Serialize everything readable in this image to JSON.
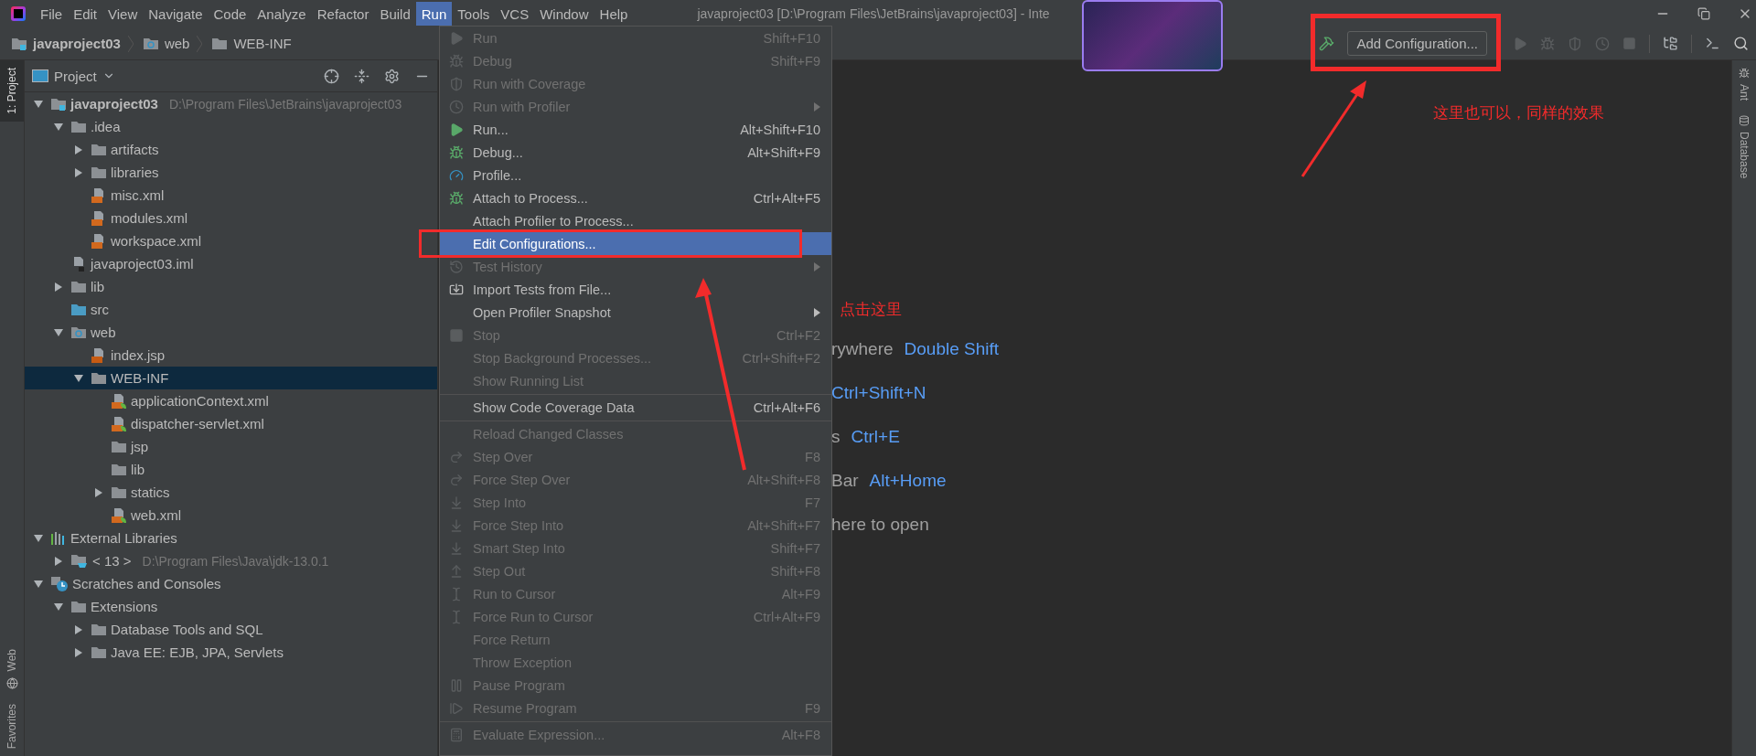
{
  "title_bar": {
    "menus": [
      {
        "label": "File",
        "selected": false
      },
      {
        "label": "Edit",
        "selected": false
      },
      {
        "label": "View",
        "selected": false
      },
      {
        "label": "Navigate",
        "selected": false
      },
      {
        "label": "Code",
        "selected": false
      },
      {
        "label": "Analyze",
        "selected": false
      },
      {
        "label": "Refactor",
        "selected": false
      },
      {
        "label": "Build",
        "selected": false
      },
      {
        "label": "Run",
        "selected": true
      },
      {
        "label": "Tools",
        "selected": false
      },
      {
        "label": "VCS",
        "selected": false
      },
      {
        "label": "Window",
        "selected": false
      },
      {
        "label": "Help",
        "selected": false
      }
    ],
    "title": "javaproject03 [D:\\Program Files\\JetBrains\\javaproject03] - Inte"
  },
  "nav_bar": {
    "breadcrumbs": [
      {
        "label": "javaproject03",
        "kind": "module"
      },
      {
        "label": "web",
        "kind": "web-folder"
      },
      {
        "label": "WEB-INF",
        "kind": "folder"
      }
    ],
    "run_config_button": "Add Configuration..."
  },
  "left_strip": {
    "top": [
      {
        "label": "1: Project",
        "selected": true
      }
    ],
    "bottom": [
      {
        "label": "Web",
        "selected": false
      },
      {
        "label": "Favorites",
        "selected": false
      }
    ]
  },
  "right_strip": [
    {
      "label": "Ant"
    },
    {
      "label": "Database"
    }
  ],
  "project_panel": {
    "title": "Project",
    "tree": [
      {
        "label": "javaproject03",
        "kind": "module",
        "path": "D:\\Program Files\\JetBrains\\javaproject03",
        "expanded": true,
        "selected": false,
        "children": [
          {
            "label": ".idea",
            "kind": "folder",
            "expanded": true,
            "selected": false,
            "children": [
              {
                "label": "artifacts",
                "kind": "folder",
                "expanded": false,
                "selected": false
              },
              {
                "label": "libraries",
                "kind": "folder",
                "expanded": false,
                "selected": false
              },
              {
                "label": "misc.xml",
                "kind": "xml-file",
                "selected": false
              },
              {
                "label": "modules.xml",
                "kind": "xml-file",
                "selected": false
              },
              {
                "label": "workspace.xml",
                "kind": "xml-file",
                "selected": false
              }
            ]
          },
          {
            "label": "javaproject03.iml",
            "kind": "iml-file",
            "selected": false
          },
          {
            "label": "lib",
            "kind": "folder",
            "expanded": false,
            "selected": false
          },
          {
            "label": "src",
            "kind": "source-folder",
            "selected": false
          },
          {
            "label": "web",
            "kind": "web-folder",
            "expanded": true,
            "selected": false,
            "children": [
              {
                "label": "index.jsp",
                "kind": "jsp-file",
                "selected": false
              },
              {
                "label": "WEB-INF",
                "kind": "folder",
                "expanded": true,
                "selected": true,
                "children": [
                  {
                    "label": "applicationContext.xml",
                    "kind": "spring-xml",
                    "selected": false
                  },
                  {
                    "label": "dispatcher-servlet.xml",
                    "kind": "spring-xml",
                    "selected": false
                  },
                  {
                    "label": "jsp",
                    "kind": "folder",
                    "selected": false
                  },
                  {
                    "label": "lib",
                    "kind": "folder",
                    "selected": false
                  },
                  {
                    "label": "statics",
                    "kind": "folder",
                    "expanded": false,
                    "selected": false
                  },
                  {
                    "label": "web.xml",
                    "kind": "web-xml",
                    "selected": false
                  }
                ]
              }
            ]
          }
        ]
      },
      {
        "label": "External Libraries",
        "kind": "libraries",
        "expanded": true,
        "selected": false,
        "children": [
          {
            "label": "< 13 >",
            "kind": "sdk",
            "path": "D:\\Program Files\\Java\\jdk-13.0.1",
            "expanded": false,
            "selected": false
          }
        ]
      },
      {
        "label": "Scratches and Consoles",
        "kind": "scratches",
        "expanded": true,
        "selected": false,
        "children": [
          {
            "label": "Extensions",
            "kind": "folder",
            "expanded": true,
            "selected": false,
            "children": [
              {
                "label": "Database Tools and SQL",
                "kind": "folder",
                "expanded": false,
                "selected": false
              },
              {
                "label": "Java EE: EJB, JPA, Servlets",
                "kind": "folder",
                "expanded": false,
                "selected": false
              }
            ]
          }
        ]
      }
    ]
  },
  "run_menu": {
    "items": [
      {
        "kind": "command",
        "label": "Run",
        "shortcut": "Shift+F10",
        "disabled": true,
        "selected": false
      },
      {
        "kind": "command",
        "label": "Debug",
        "shortcut": "Shift+F9",
        "disabled": true,
        "selected": false
      },
      {
        "kind": "command",
        "label": "Run with Coverage",
        "disabled": true,
        "selected": false
      },
      {
        "kind": "command",
        "label": "Run with Profiler",
        "disabled": true,
        "submenu": true,
        "selected": false
      },
      {
        "kind": "command",
        "label": "Run...",
        "shortcut": "Alt+Shift+F10",
        "disabled": false,
        "selected": false
      },
      {
        "kind": "command",
        "label": "Debug...",
        "shortcut": "Alt+Shift+F9",
        "disabled": false,
        "selected": false
      },
      {
        "kind": "command",
        "label": "Profile...",
        "disabled": false,
        "selected": false
      },
      {
        "kind": "command",
        "label": "Attach to Process...",
        "shortcut": "Ctrl+Alt+F5",
        "disabled": false,
        "selected": false
      },
      {
        "kind": "command",
        "label": "Attach Profiler to Process...",
        "disabled": false,
        "selected": false
      },
      {
        "kind": "command",
        "label": "Edit Configurations...",
        "disabled": false,
        "selected": true
      },
      {
        "kind": "command",
        "label": "Test History",
        "disabled": true,
        "submenu": true,
        "selected": false
      },
      {
        "kind": "command",
        "label": "Import Tests from File...",
        "disabled": false,
        "selected": false
      },
      {
        "kind": "command",
        "label": "Open Profiler Snapshot",
        "disabled": false,
        "submenu": true,
        "selected": false
      },
      {
        "kind": "command",
        "label": "Stop",
        "shortcut": "Ctrl+F2",
        "disabled": true,
        "selected": false
      },
      {
        "kind": "command",
        "label": "Stop Background Processes...",
        "shortcut": "Ctrl+Shift+F2",
        "disabled": true,
        "selected": false
      },
      {
        "kind": "command",
        "label": "Show Running List",
        "disabled": true,
        "selected": false
      },
      {
        "kind": "separator"
      },
      {
        "kind": "command",
        "label": "Show Code Coverage Data",
        "shortcut": "Ctrl+Alt+F6",
        "disabled": false,
        "selected": false
      },
      {
        "kind": "separator"
      },
      {
        "kind": "command",
        "label": "Reload Changed Classes",
        "disabled": true,
        "selected": false
      },
      {
        "kind": "command",
        "label": "Step Over",
        "shortcut": "F8",
        "disabled": true,
        "selected": false
      },
      {
        "kind": "command",
        "label": "Force Step Over",
        "shortcut": "Alt+Shift+F8",
        "disabled": true,
        "selected": false
      },
      {
        "kind": "command",
        "label": "Step Into",
        "shortcut": "F7",
        "disabled": true,
        "selected": false
      },
      {
        "kind": "command",
        "label": "Force Step Into",
        "shortcut": "Alt+Shift+F7",
        "disabled": true,
        "selected": false
      },
      {
        "kind": "command",
        "label": "Smart Step Into",
        "shortcut": "Shift+F7",
        "disabled": true,
        "selected": false
      },
      {
        "kind": "command",
        "label": "Step Out",
        "shortcut": "Shift+F8",
        "disabled": true,
        "selected": false
      },
      {
        "kind": "command",
        "label": "Run to Cursor",
        "shortcut": "Alt+F9",
        "disabled": true,
        "selected": false
      },
      {
        "kind": "command",
        "label": "Force Run to Cursor",
        "shortcut": "Ctrl+Alt+F9",
        "disabled": true,
        "selected": false
      },
      {
        "kind": "command",
        "label": "Force Return",
        "disabled": true,
        "selected": false
      },
      {
        "kind": "command",
        "label": "Throw Exception",
        "disabled": true,
        "selected": false
      },
      {
        "kind": "command",
        "label": "Pause Program",
        "disabled": true,
        "selected": false
      },
      {
        "kind": "command",
        "label": "Resume Program",
        "shortcut": "F9",
        "disabled": true,
        "selected": false
      },
      {
        "kind": "separator"
      },
      {
        "kind": "command",
        "label": "Evaluate Expression...",
        "shortcut": "Alt+F8",
        "disabled": true,
        "selected": false
      }
    ]
  },
  "editor": {
    "hints": [
      {
        "text": "rywhere",
        "shortcut": "Double Shift"
      },
      {
        "shortcut": "Ctrl+Shift+N"
      },
      {
        "text": "s",
        "shortcut": "Ctrl+E"
      },
      {
        "text": "Bar",
        "shortcut": "Alt+Home"
      },
      {
        "text": "here to open"
      }
    ]
  },
  "annotations": [
    {
      "text": "这里也可以，同样的效果"
    },
    {
      "text": "点击这里"
    }
  ]
}
